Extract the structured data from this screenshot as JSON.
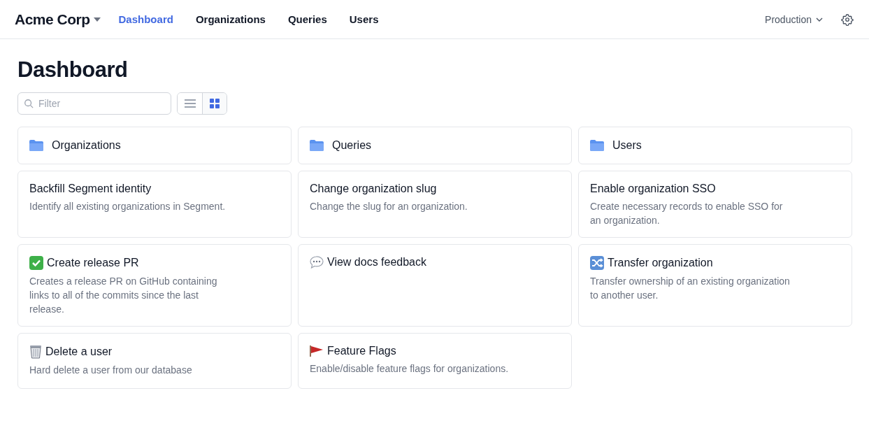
{
  "brand": "Acme Corp",
  "nav": [
    {
      "label": "Dashboard",
      "selected": true
    },
    {
      "label": "Organizations",
      "selected": false
    },
    {
      "label": "Queries",
      "selected": false
    },
    {
      "label": "Users",
      "selected": false
    }
  ],
  "environment": "Production",
  "page_title": "Dashboard",
  "filter": {
    "placeholder": "Filter"
  },
  "view_toggle": [
    {
      "kind": "list",
      "selected": false
    },
    {
      "kind": "grid",
      "selected": true
    }
  ],
  "cards": [
    {
      "kind": "folder",
      "title": "Organizations"
    },
    {
      "kind": "folder",
      "title": "Queries"
    },
    {
      "kind": "folder",
      "title": "Users"
    },
    {
      "kind": "action",
      "title": "Backfill Segment identity",
      "description": "Identify all existing organizations in Segment."
    },
    {
      "kind": "action",
      "title": "Change organization slug",
      "description": "Change the slug for an organization."
    },
    {
      "kind": "action",
      "title": "Enable organization SSO",
      "description": "Create necessary records to enable SSO for an organization."
    },
    {
      "kind": "check",
      "title": "Create release PR",
      "description": "Creates a release PR on GitHub containing links to all of the commits since the last release."
    },
    {
      "kind": "comment",
      "title": "View docs feedback"
    },
    {
      "kind": "shuffle",
      "title": "Transfer organization",
      "description": "Transfer ownership of an existing organization to another user."
    },
    {
      "kind": "trash",
      "title": "Delete a user",
      "description": "Hard delete a user from our database"
    },
    {
      "kind": "flag",
      "title": "Feature Flags",
      "description": "Enable/disable feature flags for organizations."
    }
  ]
}
